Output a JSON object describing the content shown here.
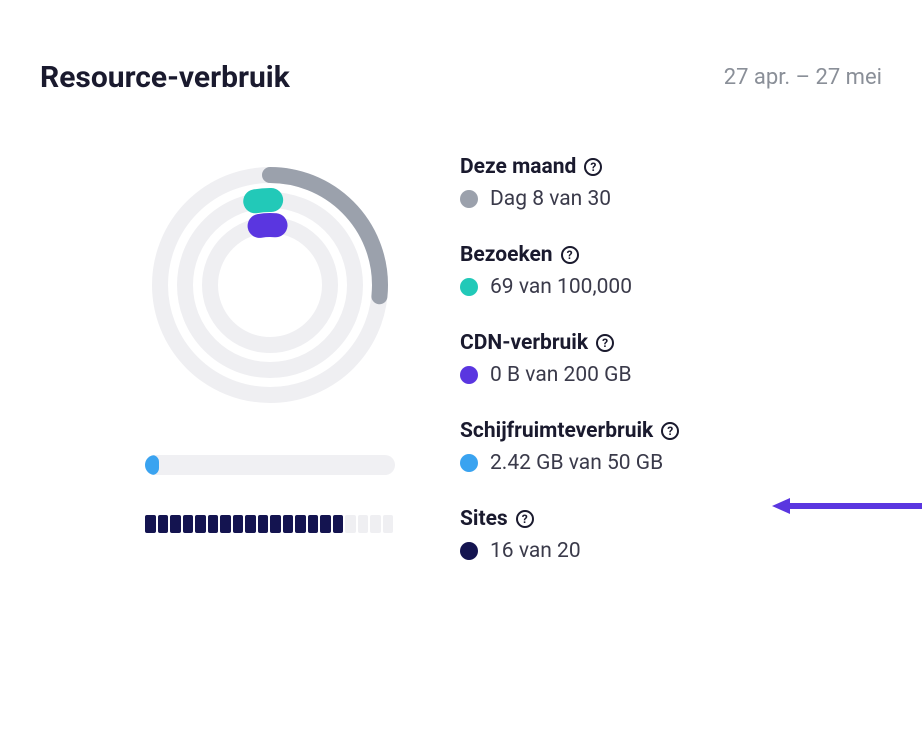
{
  "header": {
    "title": "Resource-verbruik",
    "dateRange": "27 apr. – 27 mei"
  },
  "legend": {
    "month": {
      "label": "Deze maand",
      "value": "Dag 8 van 30",
      "color": "#9ba1ac"
    },
    "visits": {
      "label": "Bezoeken",
      "value": "69 van 100,000",
      "color": "#22c9b8"
    },
    "cdn": {
      "label": "CDN-verbruik",
      "value": "0 B van 200 GB",
      "color": "#5a36e0"
    },
    "disk": {
      "label": "Schijfruimteverbruik",
      "value": "2.42 GB van 50 GB",
      "color": "#3aa3f0"
    },
    "sites": {
      "label": "Sites",
      "value": "16 van 20",
      "color": "#141450"
    }
  },
  "chart_data": {
    "type": "pie",
    "title": "Resource-verbruik",
    "series": [
      {
        "name": "Deze maand",
        "value": 8,
        "max": 30,
        "color": "#9ba1ac"
      },
      {
        "name": "Bezoeken",
        "value": 69,
        "max": 100000,
        "color": "#22c9b8"
      },
      {
        "name": "CDN-verbruik",
        "value": 0,
        "max": 200,
        "unit": "GB",
        "color": "#5a36e0"
      }
    ],
    "bars": [
      {
        "name": "Schijfruimteverbruik",
        "value": 2.42,
        "max": 50,
        "unit": "GB",
        "color": "#3aa3f0"
      },
      {
        "name": "Sites",
        "value": 16,
        "max": 20,
        "color": "#141450"
      }
    ]
  },
  "colors": {
    "arrow": "#5a36e0"
  }
}
